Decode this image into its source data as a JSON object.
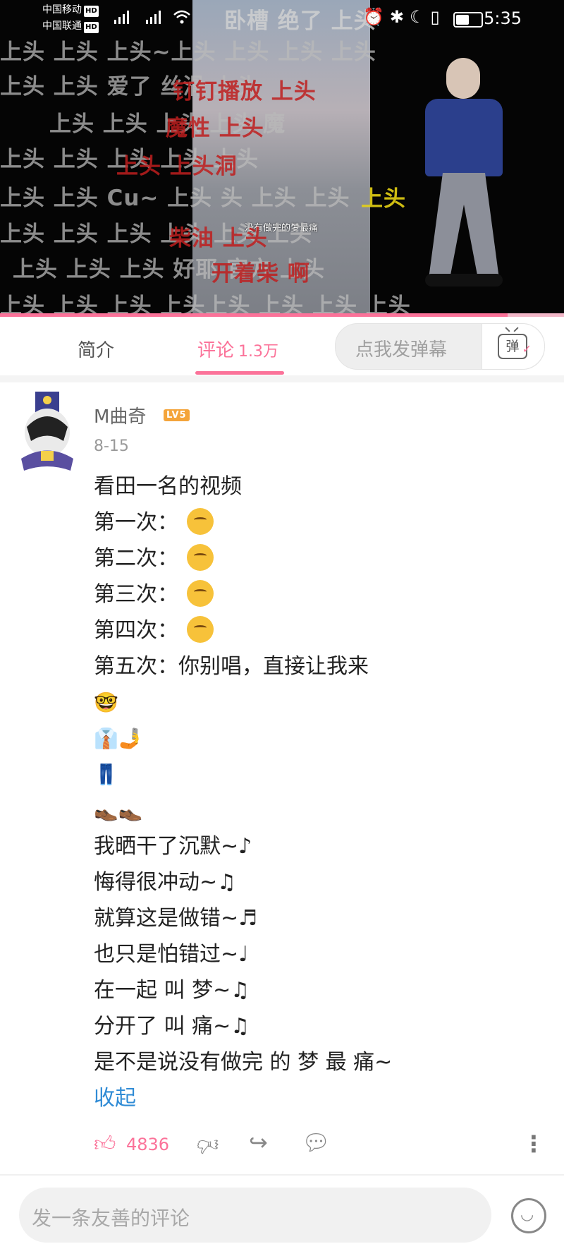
{
  "status_bar": {
    "carrier_1": "中国移动",
    "carrier_2": "中国联通",
    "hd_badge": "HD",
    "network_1": "4G",
    "network_2": "5G",
    "time": "5:35"
  },
  "video": {
    "caption": "没有做完的梦最痛",
    "progress_fraction": 0.9,
    "danmaku_gray": [
      "上头    上头 上头~上头       上头 上头 上头",
      "上头       上头                              爱了  丝滑       上头",
      "上头 上头                                           上头    上头   魔",
      "上头  上头                                         上头 上头 上头",
      "上头 上头   Cu~  上头    头                       上头 上头",
      "上头  上头 上头                                  上头    上头  上头",
      "上头 上头 上头          好耶     官方  上头",
      "上头 上头       上头  上头上头     上头  上头  上头"
    ],
    "danmaku_red": [
      "钉钉播放   上头",
      "魔性     上头",
      "上头      上头洞",
      "柴油     上头",
      "开着柴    啊"
    ],
    "danmaku_yellow": [
      "卧槽  绝了  上头",
      "上头"
    ]
  },
  "tabs": {
    "intro": "简介",
    "comments": "评论",
    "comments_count": "1.3万",
    "danmaku_placeholder": "点我发弹幕",
    "danmaku_icon_label": "弹"
  },
  "comment": {
    "username": "M曲奇",
    "level": "LV5",
    "date": "8-15",
    "lines": [
      "看田一名的视频",
      "第一次：",
      "第二次：",
      "第三次：",
      "第四次：",
      "第五次：你别唱，直接让我来",
      "🤓",
      "👔🤳",
      "👖",
      "👞👞",
      "我晒干了沉默~♪",
      "悔得很冲动~♫",
      "就算这是做错~♬",
      "也只是怕错过~♩",
      "在一起 叫 梦~♫",
      "分开了 叫 痛~♫",
      "是不是说没有做完  的  梦  最  痛~"
    ],
    "collapse": "收起",
    "like_count": "4836"
  },
  "bottom": {
    "placeholder": "发一条友善的评论"
  },
  "colors": {
    "accent": "#fb7299",
    "link": "#2f8bd5",
    "level_badge": "#f4a43a"
  },
  "icons": {
    "like": "thumbs-up-icon",
    "dislike": "thumbs-down-icon",
    "share": "share-icon",
    "reply": "reply-icon",
    "more": "more-icon",
    "emoji": "emoji-icon",
    "danmaku": "danmaku-tv-icon"
  }
}
